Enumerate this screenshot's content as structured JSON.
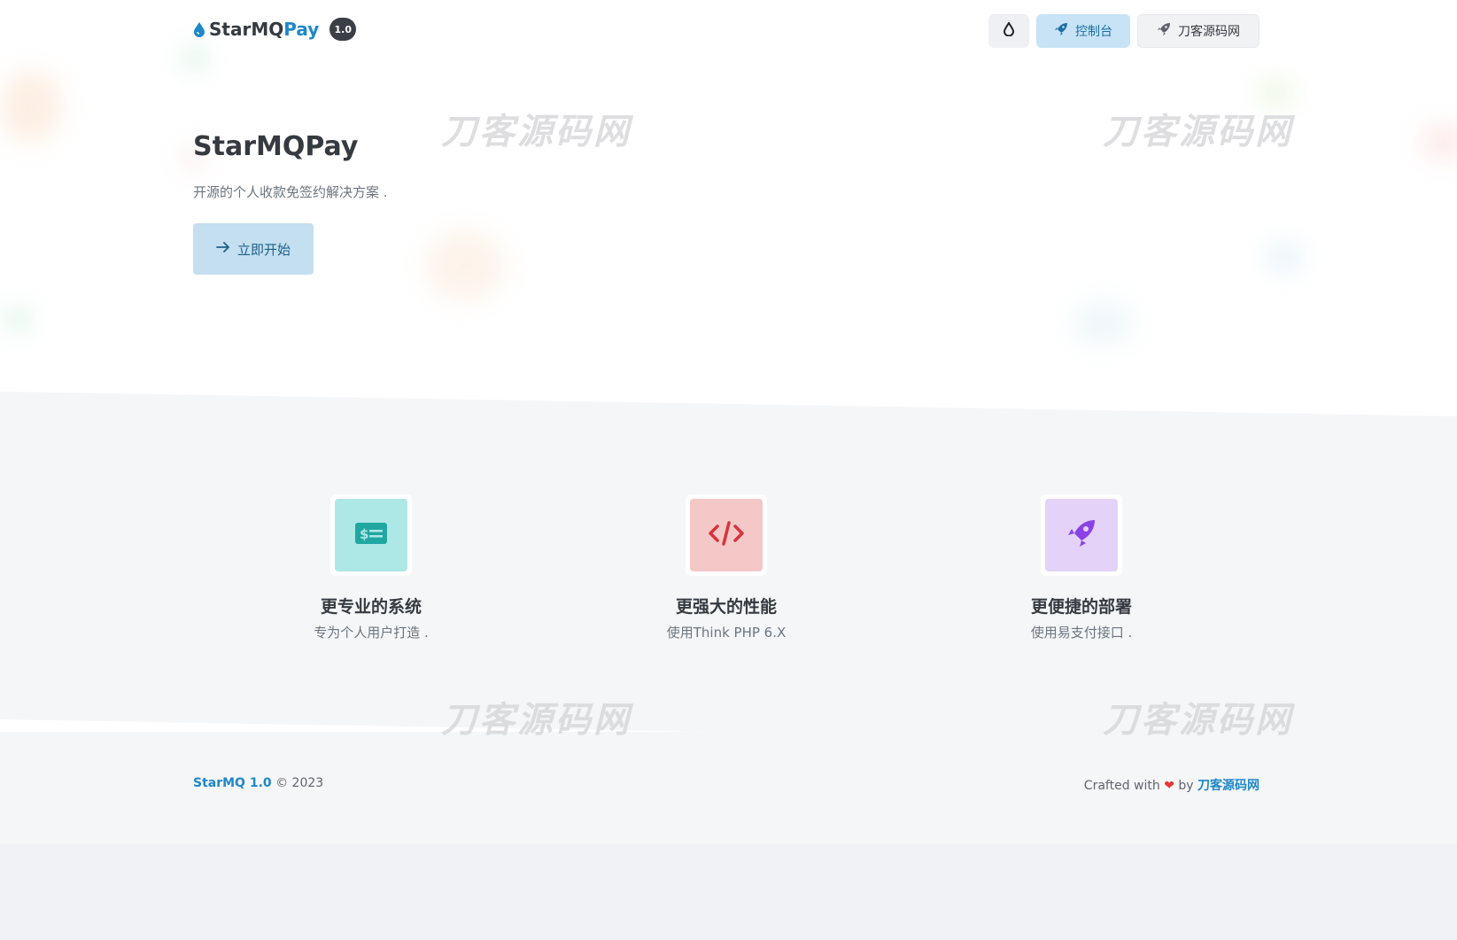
{
  "header": {
    "brand_main": "StarMQ",
    "brand_accent": "Pay",
    "version": "1.0",
    "theme_icon": "drop-icon",
    "console_label": "控制台",
    "site_label": "刀客源码网"
  },
  "hero": {
    "title": "StarMQPay",
    "subtitle": "开源的个人收款免签约解决方案 .",
    "start_label": "立即开始"
  },
  "watermark": {
    "text": "刀客源码网"
  },
  "features": [
    {
      "icon": "money-card-icon",
      "title": "更专业的系统",
      "desc": "专为个人用户打造 .",
      "bg": "#aee8e6",
      "fg": "#20a7a2"
    },
    {
      "icon": "code-icon",
      "title": "更强大的性能",
      "desc": "使用Think PHP 6.X",
      "bg": "#f5c8c8",
      "fg": "#d8333b"
    },
    {
      "icon": "rocket-icon",
      "title": "更便捷的部署",
      "desc": "使用易支付接口 .",
      "bg": "#e4d2f8",
      "fg": "#8a42e6"
    }
  ],
  "footer": {
    "brand": "StarMQ 1.0",
    "copyright": "© 2023",
    "crafted": "Crafted with",
    "by": "by",
    "site": "刀客源码网"
  },
  "colors": {
    "accent": "#1e88c8",
    "dark": "#343a40",
    "muted": "#6c757d"
  }
}
